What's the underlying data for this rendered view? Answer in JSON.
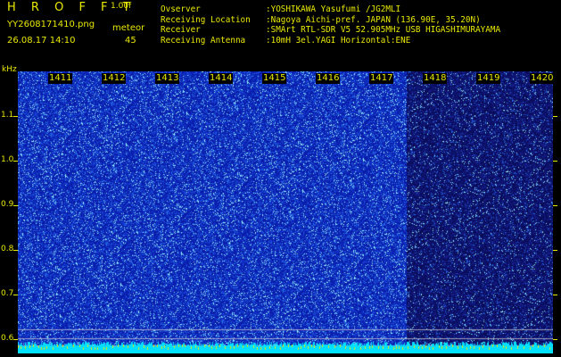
{
  "header": {
    "brand": "H R O F F T",
    "version": "1.00f",
    "filename": "YY2608171410.png",
    "mode": "meteor",
    "datetime": "26.08.17 14:10",
    "count": "45"
  },
  "meta": [
    {
      "key": "Ovserver",
      "value": ":YOSHIKAWA Yasufumi /JG2MLI"
    },
    {
      "key": "Receiving Location",
      "value": ":Nagoya Aichi-pref. JAPAN (136.90E, 35.20N)"
    },
    {
      "key": "Receiver",
      "value": ":SMArt RTL-SDR V5 52.905MHz USB HIGASHIMURAYAMA"
    },
    {
      "key": "Receiving Antenna",
      "value": ":10mH 3el.YAGI Horizontal:ENE"
    }
  ],
  "axis": {
    "unit": "kHz",
    "y_ticks": [
      "1.1",
      "1.0",
      "0.9",
      "0.8",
      "0.7",
      "0.6"
    ],
    "minutes": [
      "1411",
      "1412",
      "1413",
      "1414",
      "1415",
      "1416",
      "1417",
      "1418",
      "1419",
      "1420"
    ]
  },
  "colors": {
    "text": "#e8e800",
    "background": "#000000",
    "spectrum_base": "#0a1aa8",
    "noise_floor": "#00e0ff"
  }
}
